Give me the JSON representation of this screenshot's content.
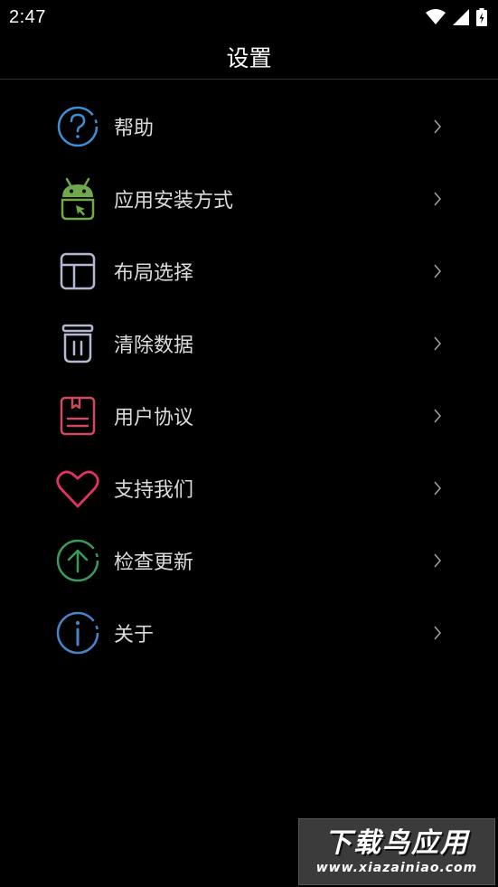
{
  "status_bar": {
    "time": "2:47",
    "icons": [
      "wifi-icon",
      "signal-icon",
      "battery-icon"
    ]
  },
  "header": {
    "title": "设置"
  },
  "menu": {
    "items": [
      {
        "label": "帮助",
        "icon": "help-icon",
        "color": "#3d8fd6"
      },
      {
        "label": "应用安装方式",
        "icon": "android-icon",
        "color": "#6fa84d"
      },
      {
        "label": "布局选择",
        "icon": "layout-icon",
        "color": "#b4b8d0"
      },
      {
        "label": "清除数据",
        "icon": "trash-icon",
        "color": "#b4b8d0"
      },
      {
        "label": "用户协议",
        "icon": "agreement-icon",
        "color": "#d04a5e"
      },
      {
        "label": "支持我们",
        "icon": "heart-icon",
        "color": "#e0335f"
      },
      {
        "label": "检查更新",
        "icon": "upload-icon",
        "color": "#3a9a5e"
      },
      {
        "label": "关于",
        "icon": "info-icon",
        "color": "#4a82c8"
      }
    ]
  },
  "watermark": {
    "title": "下载鸟应用",
    "url": "www.xiazainiao.com"
  }
}
